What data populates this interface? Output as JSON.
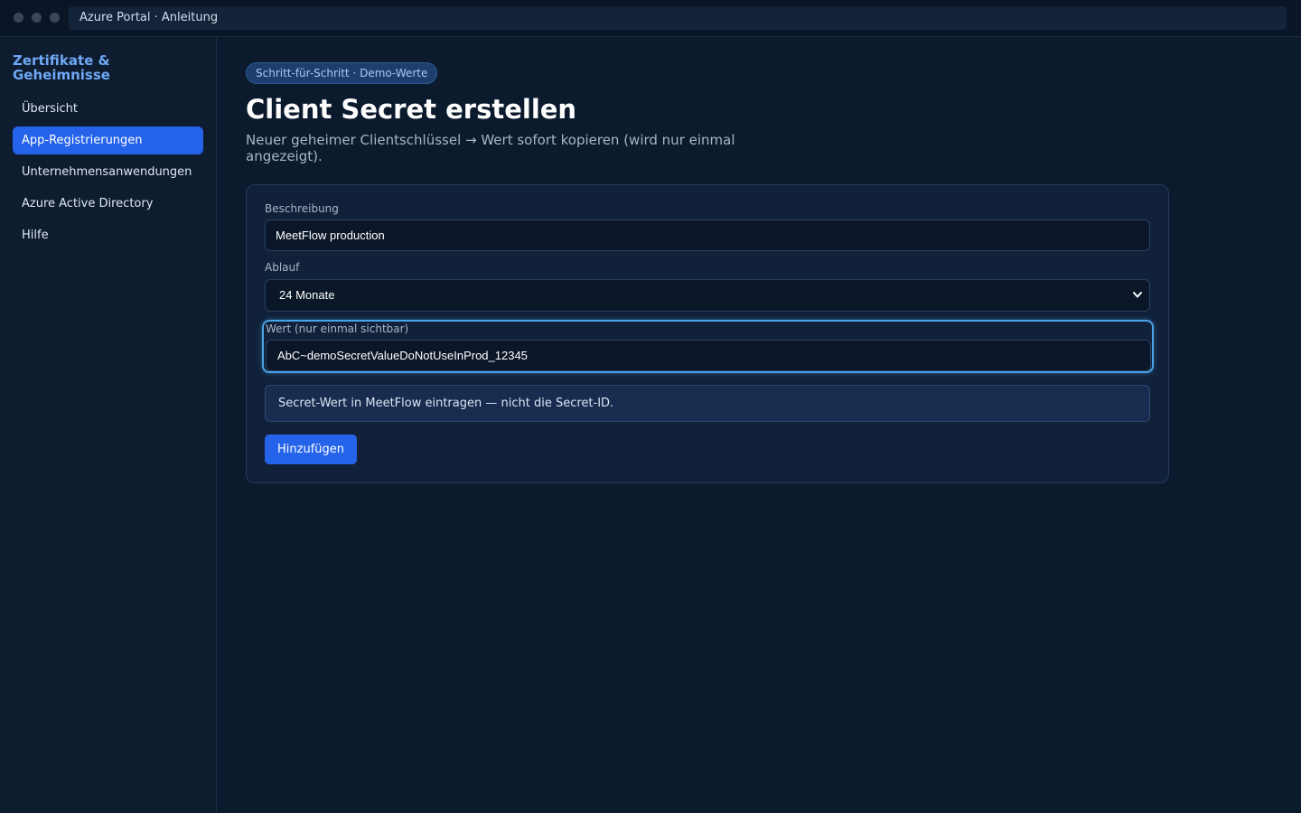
{
  "window": {
    "url_text": "Azure Portal · Anleitung"
  },
  "sidebar": {
    "title": "Zertifikate & Geheimnisse",
    "items": [
      {
        "label": "Übersicht",
        "active": false
      },
      {
        "label": "App-Registrierungen",
        "active": true
      },
      {
        "label": "Unternehmensanwendungen",
        "active": false
      },
      {
        "label": "Azure Active Directory",
        "active": false
      },
      {
        "label": "Hilfe",
        "active": false
      }
    ]
  },
  "main": {
    "badge": "Schritt-für-Schritt · Demo-Werte",
    "title": "Client Secret erstellen",
    "subtitle": "Neuer geheimer Clientschlüssel → Wert sofort kopieren (wird nur einmal angezeigt).",
    "form": {
      "description_label": "Beschreibung",
      "description_value": "MeetFlow production",
      "expiry_label": "Ablauf",
      "expiry_value": "24 Monate",
      "value_label": "Wert (nur einmal sichtbar)",
      "value_value": "AbC~demoSecretValueDoNotUseInProd_12345",
      "note": "Secret-Wert in MeetFlow eintragen — nicht die Secret-ID.",
      "add_button": "Hinzufügen"
    }
  },
  "colors": {
    "accent": "#2563eb",
    "highlight": "#4aa3e8",
    "background": "#0b1a2d"
  },
  "icons": {
    "select_chevron": "chevron-down-icon"
  }
}
